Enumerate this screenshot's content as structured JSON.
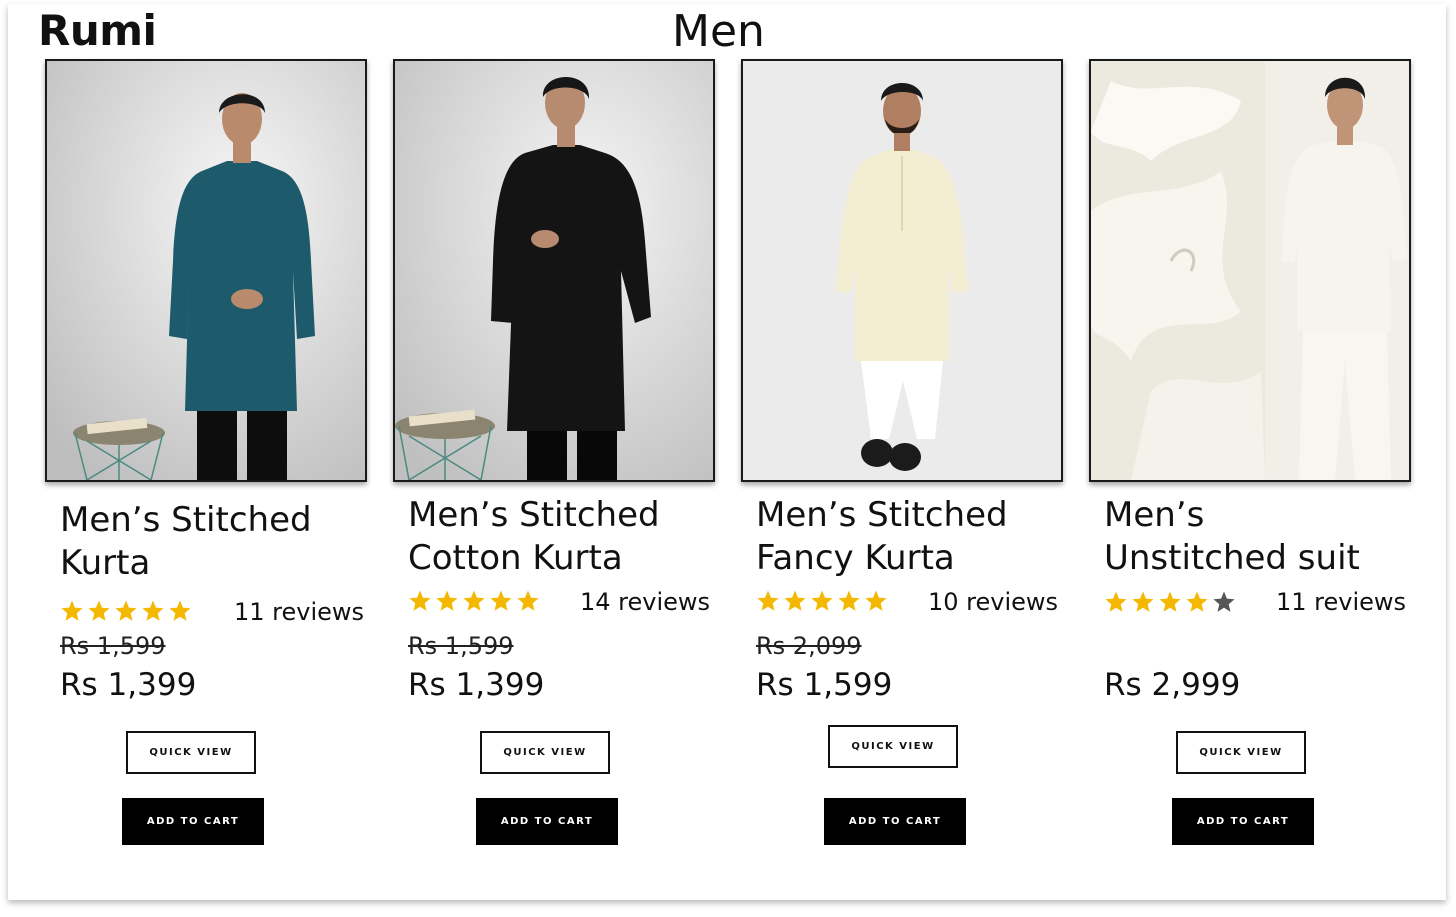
{
  "header": {
    "brand": "Rumi",
    "category": "Men"
  },
  "colors": {
    "star_filled": "#F5B800",
    "star_empty": "#555555",
    "button_dark": "#000000"
  },
  "products": [
    {
      "name_line1": "Men’s Stitched",
      "name_line2": "Kurta",
      "rating": 5,
      "reviews": "11 reviews",
      "old_price": "Rs 1,599",
      "price": "Rs 1,399",
      "quick_view": "QUICK VIEW",
      "add_to_cart": "ADD TO CART",
      "image": "man-in-teal-kurta"
    },
    {
      "name_line1": "Men’s Stitched",
      "name_line2": "Cotton Kurta",
      "rating": 5,
      "reviews": "14 reviews",
      "old_price": "Rs 1,599",
      "price": "Rs 1,399",
      "quick_view": "QUICK VIEW",
      "add_to_cart": "ADD TO CART",
      "image": "man-in-black-kurta"
    },
    {
      "name_line1": "Men’s Stitched",
      "name_line2": "Fancy Kurta",
      "rating": 5,
      "reviews": "10 reviews",
      "old_price": "Rs 2,099",
      "price": "Rs 1,599",
      "quick_view": "QUICK VIEW",
      "add_to_cart": "ADD TO CART",
      "image": "man-in-cream-kurta"
    },
    {
      "name_line1": "Men’s",
      "name_line2": "Unstitched suit",
      "rating": 4,
      "reviews": "11 reviews",
      "old_price": "",
      "price": "Rs 2,999",
      "quick_view": "QUICK VIEW",
      "add_to_cart": "ADD TO CART",
      "image": "white-fabric-and-suit"
    }
  ]
}
